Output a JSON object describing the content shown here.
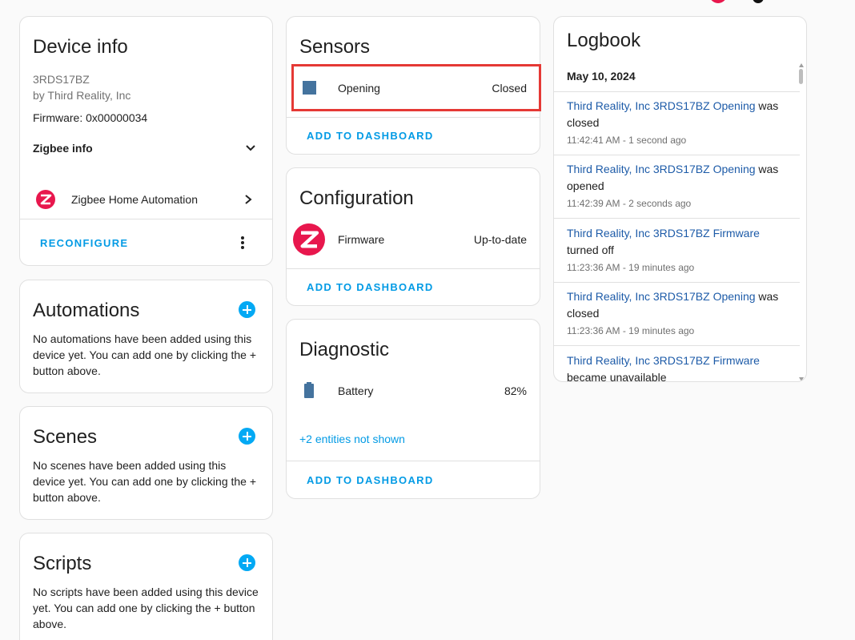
{
  "device_info": {
    "title": "Device info",
    "model": "3RDS17BZ",
    "manufacturer": "by Third Reality, Inc",
    "firmware": "Firmware: 0x00000034",
    "zigbee_info_label": "Zigbee info",
    "integration_label": "Zigbee Home Automation",
    "reconfigure_label": "RECONFIGURE"
  },
  "automations": {
    "title": "Automations",
    "text": "No automations have been added using this device yet. You can add one by clicking the + button above."
  },
  "scenes": {
    "title": "Scenes",
    "text": "No scenes have been added using this device yet. You can add one by clicking the + button above."
  },
  "scripts": {
    "title": "Scripts",
    "text": "No scripts have been added using this device yet. You can add one by clicking the + button above."
  },
  "sensors": {
    "title": "Sensors",
    "row_label": "Opening",
    "row_value": "Closed",
    "action_label": "ADD TO DASHBOARD"
  },
  "configuration": {
    "title": "Configuration",
    "row_label": "Firmware",
    "row_value": "Up-to-date",
    "action_label": "ADD TO DASHBOARD"
  },
  "diagnostic": {
    "title": "Diagnostic",
    "row_label": "Battery",
    "row_value": "82%",
    "hidden_entities": "+2 entities not shown",
    "action_label": "ADD TO DASHBOARD"
  },
  "logbook": {
    "title": "Logbook",
    "date": "May 10, 2024",
    "entries": [
      {
        "entity": "Third Reality, Inc 3RDS17BZ Opening",
        "action": "was",
        "action2": "closed",
        "time": "11:42:41 AM - 1 second ago"
      },
      {
        "entity": "Third Reality, Inc 3RDS17BZ Opening",
        "action": "was",
        "action2": "opened",
        "time": "11:42:39 AM - 2 seconds ago"
      },
      {
        "entity": "Third Reality, Inc 3RDS17BZ Firmware",
        "action": "",
        "action2": "turned off",
        "time": "11:23:36 AM - 19 minutes ago"
      },
      {
        "entity": "Third Reality, Inc 3RDS17BZ Opening",
        "action": "was",
        "action2": "closed",
        "time": "11:23:36 AM - 19 minutes ago"
      },
      {
        "entity": "Third Reality, Inc 3RDS17BZ Firmware",
        "action": "",
        "action2": "became unavailable",
        "time": ""
      }
    ]
  },
  "colors": {
    "accent": "#03a9f4",
    "link": "#1d5ba8",
    "highlight": "#e53935",
    "zigbee": "#e8174d",
    "sensor_icon": "#44739e"
  },
  "icons": {
    "sensor": "square-icon",
    "battery": "battery-icon",
    "zigbee": "zigbee-logo-icon",
    "expand": "chevron-down-icon",
    "navigate": "chevron-right-icon",
    "more": "more-vertical-icon",
    "add": "plus-circle-icon"
  }
}
